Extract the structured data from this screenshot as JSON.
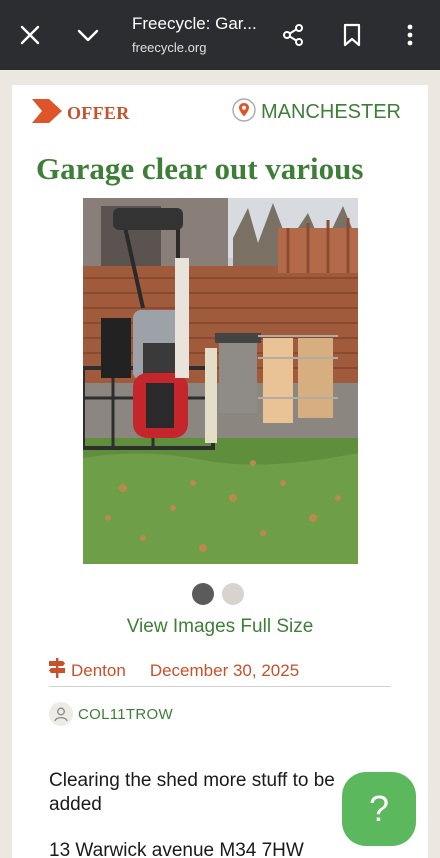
{
  "browser": {
    "title": "Freecycle: Gar...",
    "url": "freecycle.org"
  },
  "post": {
    "type_label": "OFFER",
    "location": "MANCHESTER",
    "title": "Garage clear out various",
    "view_images_label": "View Images Full Size",
    "town": "Denton",
    "date": "December 30, 2025",
    "username": "COL11TROW",
    "description_line1": "Clearing the shed more stuff to be added",
    "description_line2": "13 Warwick avenue M34 7HW"
  },
  "gallery": {
    "image_count": 2,
    "active_index": 0
  },
  "help": {
    "label": "?"
  },
  "colors": {
    "brand_green": "#3e7f37",
    "brand_orange": "#c8502a",
    "help_green": "#5cb85c",
    "topbar": "#2b2d31"
  }
}
